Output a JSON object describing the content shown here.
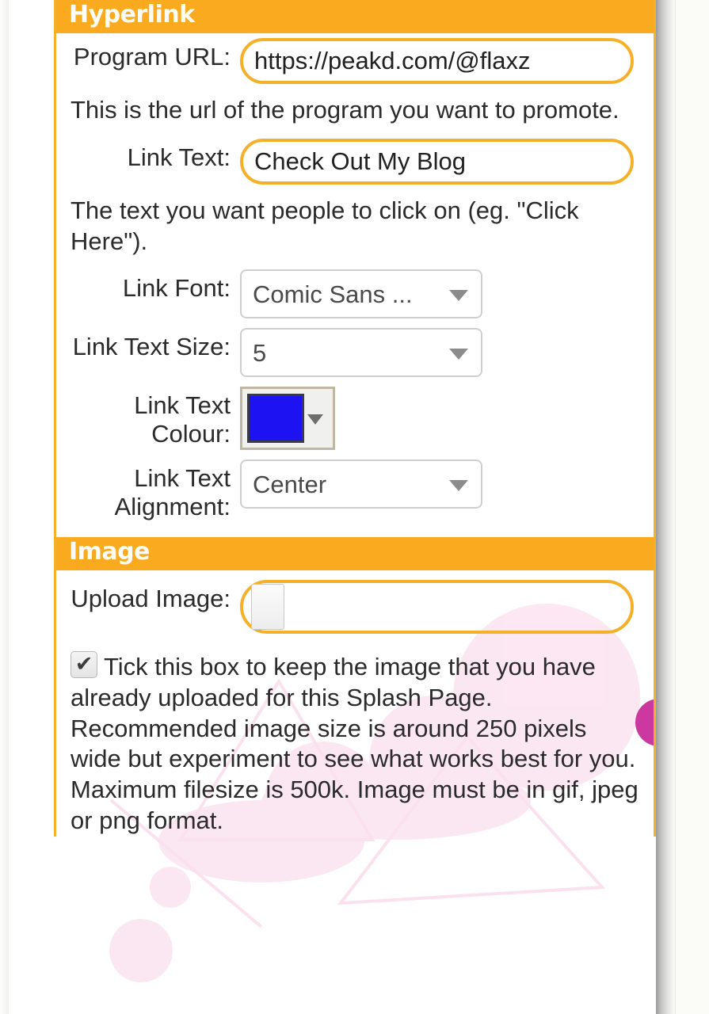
{
  "sections": [
    {
      "id": "hyperlink",
      "title": "Hyperlink",
      "fields": {
        "program_url": {
          "label": "Program URL:",
          "value": "https://peakd.com/@flaxz",
          "placeholder": "",
          "help": "This is the url of the program you want to promote."
        },
        "link_text": {
          "label": "Link Text:",
          "value": "Check Out My Blog",
          "placeholder": "",
          "help": "The text you want people to click on (eg. \"Click Here\")."
        },
        "link_font": {
          "label": "Link Font:",
          "value": "Comic Sans ..."
        },
        "link_text_size": {
          "label": "Link Text Size:",
          "value": "5"
        },
        "link_text_colour": {
          "label": "Link Text Colour:",
          "value": "#1c12f2"
        },
        "link_text_alignment": {
          "label": "Link Text Alignment:",
          "value": "Center"
        }
      }
    },
    {
      "id": "image",
      "title": "Image",
      "fields": {
        "upload_image": {
          "label": "Upload Image:",
          "value": "",
          "button_label": ""
        },
        "keep_image": {
          "checked": true,
          "text": "Tick this box to keep the image that you have already uploaded for this Splash Page. Recommended image size is around 250 pixels wide but experiment to see what works best for you. Maximum filesize is 500k. Image must be in gif, jpeg or png format."
        }
      }
    }
  ],
  "theme": {
    "header_bg": "#f9aa1f",
    "panel_border": "#f3b229",
    "input_border": "#f5b02a",
    "text": "#2b2b2b",
    "select_border": "#cfcfcf",
    "deco_pink": "#fbe4f1",
    "deco_magenta": "#c2168f"
  }
}
